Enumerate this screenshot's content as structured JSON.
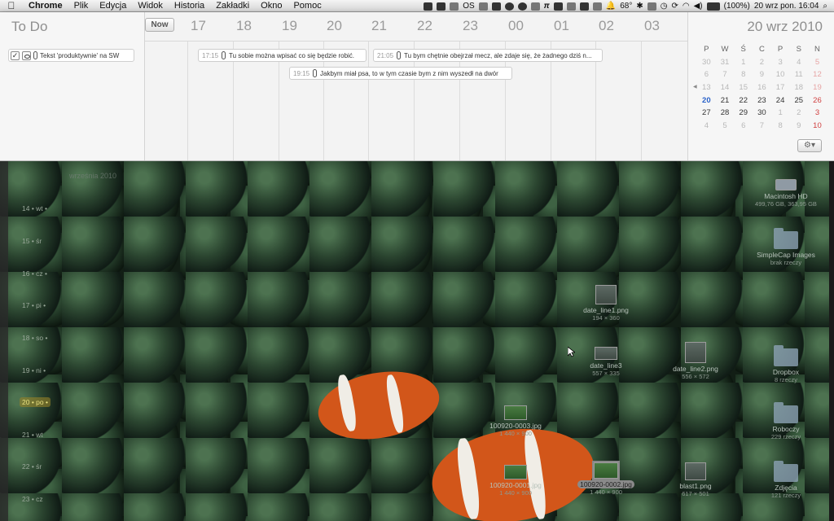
{
  "menubar": {
    "apple_icon": "apple-icon",
    "items": [
      "Chrome",
      "Plik",
      "Edycja",
      "Widok",
      "Historia",
      "Zakładki",
      "Okno",
      "Pomoc"
    ],
    "tray": {
      "os_label": "OS",
      "temperature": "68°",
      "battery": "(100%)",
      "datetime": "20 wrz pon.  16:04"
    }
  },
  "todo": {
    "title": "To Do",
    "items": [
      {
        "text": "Tekst 'produktywnie' na SW"
      }
    ]
  },
  "timeline": {
    "now_label": "Now",
    "hours": [
      "17",
      "18",
      "19",
      "20",
      "21",
      "22",
      "23",
      "00",
      "01",
      "02",
      "03"
    ],
    "events": [
      {
        "time": "17:15",
        "text": "Tu sobie można wpisać co się będzie robić."
      },
      {
        "time": "21:05",
        "text": "Tu bym chętnie obejrzał mecz, ale zdaje się, że żadnego dziś n..."
      },
      {
        "time": "19:15",
        "text": "Jakbym miał psa, to w tym czasie bym z nim wyszedł na dwór"
      }
    ]
  },
  "calendar": {
    "date_title": "20 wrz 2010",
    "weekdays": [
      "P",
      "W",
      "Ś",
      "C",
      "P",
      "S",
      "N"
    ],
    "weeks": [
      [
        "30",
        "31",
        "1",
        "2",
        "3",
        "4",
        "5"
      ],
      [
        "6",
        "7",
        "8",
        "9",
        "10",
        "11",
        "12"
      ],
      [
        "13",
        "14",
        "15",
        "16",
        "17",
        "18",
        "19"
      ],
      [
        "20",
        "21",
        "22",
        "23",
        "24",
        "25",
        "26"
      ],
      [
        "27",
        "28",
        "29",
        "30",
        "1",
        "2",
        "3"
      ],
      [
        "4",
        "5",
        "6",
        "7",
        "8",
        "9",
        "10"
      ]
    ],
    "gear_label": "⚙︎▾"
  },
  "desktop": {
    "month_label": "września 2010",
    "days": [
      {
        "label": "14 • wt •"
      },
      {
        "label": "15 • śr"
      },
      {
        "label": "16 • cz •"
      },
      {
        "label": "17 • pi •"
      },
      {
        "label": "18 • so •"
      },
      {
        "label": "19 • ni •"
      },
      {
        "label": "20 • po •"
      },
      {
        "label": "21 • wt"
      },
      {
        "label": "22 • śr"
      },
      {
        "label": "23 • cz"
      }
    ],
    "icons": [
      {
        "name": "Macintosh HD",
        "meta": "499,76 GB, 363,95 GB"
      },
      {
        "name": "SimpleCap Images",
        "meta": "brak rzeczy"
      },
      {
        "name": "date_line1.png",
        "meta": "194 × 360"
      },
      {
        "name": "date_line3",
        "meta": "557 × 335"
      },
      {
        "name": "date_line2.png",
        "meta": "556 × 572"
      },
      {
        "name": "Dropbox",
        "meta": "8 rzeczy"
      },
      {
        "name": "100920-0003.jpg",
        "meta": "1 440 × 900"
      },
      {
        "name": "Roboczy",
        "meta": "229 rzeczy"
      },
      {
        "name": "100920-0001.jpg",
        "meta": "1 440 × 900"
      },
      {
        "name": "100920-0002.jpg",
        "meta": "1 440 × 900"
      },
      {
        "name": "blast1.png",
        "meta": "617 × 501"
      },
      {
        "name": "Zdjęcia",
        "meta": "121 rzeczy"
      }
    ]
  }
}
